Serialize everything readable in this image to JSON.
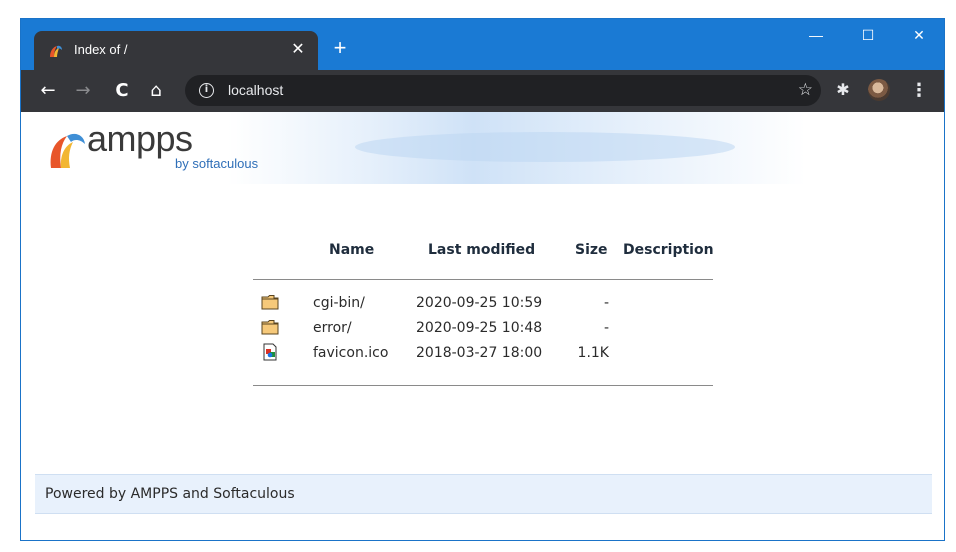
{
  "browser": {
    "tab_title": "Index of /",
    "tab_close_glyph": "✕",
    "new_tab_glyph": "+",
    "window_controls": {
      "minimize": "—",
      "maximize": "☐",
      "close": "✕"
    },
    "nav": {
      "back": "←",
      "forward": "→",
      "reload": "C",
      "home": "⌂"
    },
    "info_glyph": "i",
    "url": "localhost",
    "star_glyph": "☆",
    "extensions_glyph": "✱",
    "menu_glyph": "⋮",
    "colors": {
      "titlebar": "#1a7ad4",
      "toolbar": "#35363a",
      "omnibox": "#202124"
    }
  },
  "banner": {
    "logo_text": "ampps",
    "logo_sub": "by softaculous"
  },
  "listing": {
    "headers": {
      "name": "Name",
      "modified": "Last modified",
      "size": "Size",
      "description": "Description"
    },
    "rows": [
      {
        "icon": "folder-icon",
        "name": "cgi-bin/",
        "modified": "2020-09-25 10:59",
        "size": "-",
        "description": ""
      },
      {
        "icon": "folder-icon",
        "name": "error/",
        "modified": "2020-09-25 10:48",
        "size": "-",
        "description": ""
      },
      {
        "icon": "image-file-icon",
        "name": "favicon.ico",
        "modified": "2018-03-27 18:00",
        "size": "1.1K",
        "description": ""
      }
    ]
  },
  "footer": {
    "text": "Powered by AMPPS and Softaculous"
  }
}
